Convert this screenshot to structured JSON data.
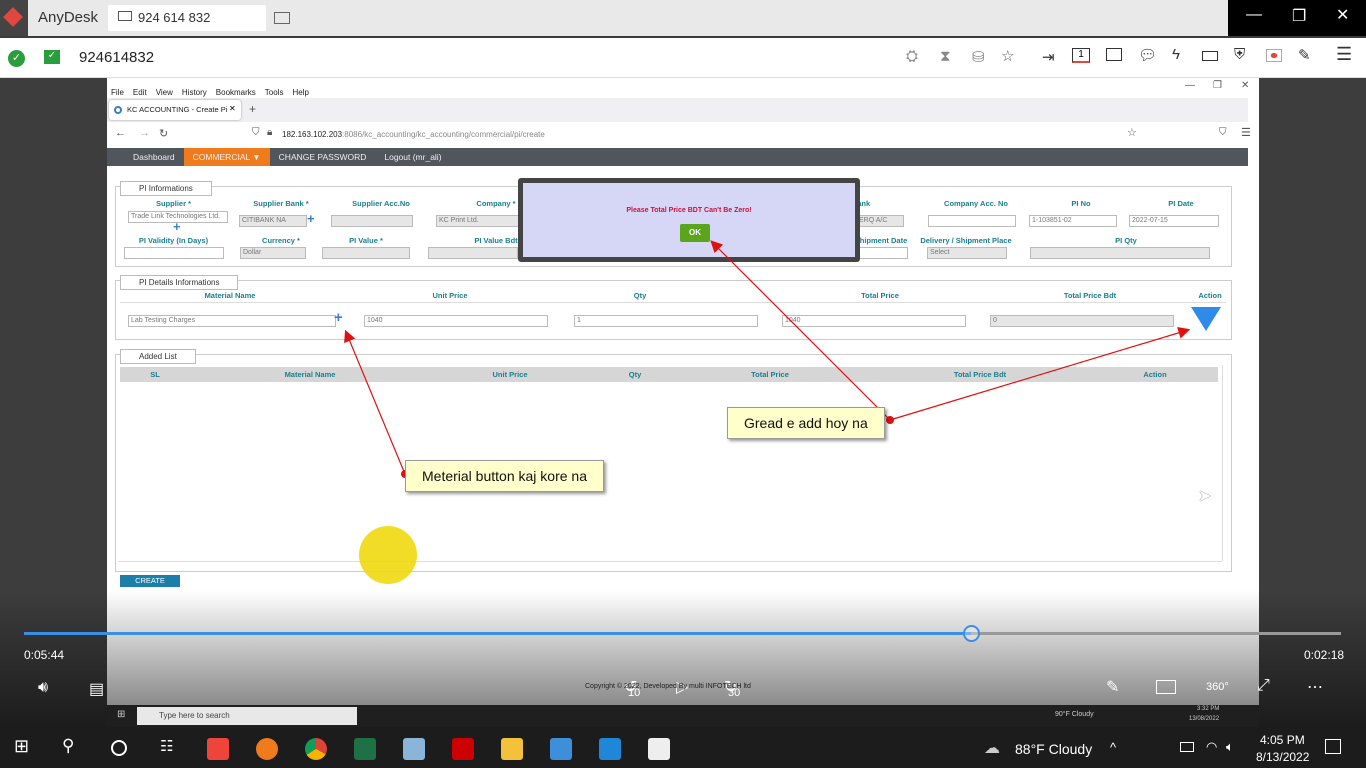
{
  "anydesk": {
    "app_name": "AnyDesk",
    "tab_id": "924 614 832",
    "session_id": "924614832",
    "toolbar_count": "1"
  },
  "browser": {
    "menu": [
      "File",
      "Edit",
      "View",
      "History",
      "Bookmarks",
      "Tools",
      "Help"
    ],
    "tab_title": "KC ACCOUNTING - Create Pi",
    "url_host": "182.163.102.203",
    "url_path": ":8086/kc_accounting/kc_accounting/commercial/pi/create"
  },
  "nav": {
    "items": [
      "Dashboard",
      "COMMERCIAL ▼",
      "CHANGE PASSWORD",
      "Logout (mr_ali)"
    ]
  },
  "pi_info": {
    "legend": "PI Informations",
    "headers1": [
      "Supplier *",
      "Supplier Bank *",
      "Supplier Acc.No",
      "Company *",
      "Bank",
      "Company Acc. No",
      "PI No",
      "PI Date"
    ],
    "values1": {
      "supplier": "Trade Link Technologies Ltd.",
      "supplier_bank": "CITIBANK NA",
      "company": "KC Print Ltd.",
      "bank": "ERQ A/C",
      "pi_no": "1-103851-02",
      "pi_date": "2022-07-15"
    },
    "headers2": [
      "PI Validity (In Days)",
      "Currency *",
      "PI Value *",
      "PI Value Bdt",
      "Shipment Date",
      "Delivery / Shipment Place",
      "PI Qty"
    ],
    "values2": {
      "currency": "Dollar",
      "delivery": "Select"
    }
  },
  "pi_details": {
    "legend": "PI Details Informations",
    "headers": [
      "Material Name",
      "Unit Price",
      "Qty",
      "Total Price",
      "Total Price Bdt",
      "Action"
    ],
    "values": {
      "material": "Lab Testing Charges",
      "unit_price": "1040",
      "qty": "1",
      "total_price": "1040",
      "total_price_bdt": "0"
    }
  },
  "added_list": {
    "legend": "Added List",
    "headers": [
      "SL",
      "Material Name",
      "Unit Price",
      "Qty",
      "Total Price",
      "Total Price Bdt",
      "Action"
    ]
  },
  "create_button": "CREATE",
  "dialog": {
    "message": "Please Total Price BDT Can't Be Zero!",
    "ok": "OK"
  },
  "annotations": {
    "material": "Meterial button kaj kore na",
    "grid": "Gread e add hoy na"
  },
  "video": {
    "elapsed": "0:05:44",
    "remaining": "0:02:18",
    "progress_percent": 71.9,
    "skip_back": "10",
    "skip_fwd": "30",
    "view_360": "360°"
  },
  "footer": "Copyright © 2022, Developed By multi INFOTECH ltd",
  "inner_taskbar": {
    "search": "Type here to search",
    "weather": "90°F Cloudy",
    "time": "3:32 PM",
    "date": "13/08/2022"
  },
  "taskbar": {
    "weather": "88°F Cloudy",
    "time": "4:05 PM",
    "date": "8/13/2022"
  },
  "colors": {
    "accent": "#f07b1d",
    "teal": "#1a7f8e",
    "dialog_bg": "#d6d6f6",
    "ok": "#5aa51c",
    "progress": "#3a8ee6"
  }
}
